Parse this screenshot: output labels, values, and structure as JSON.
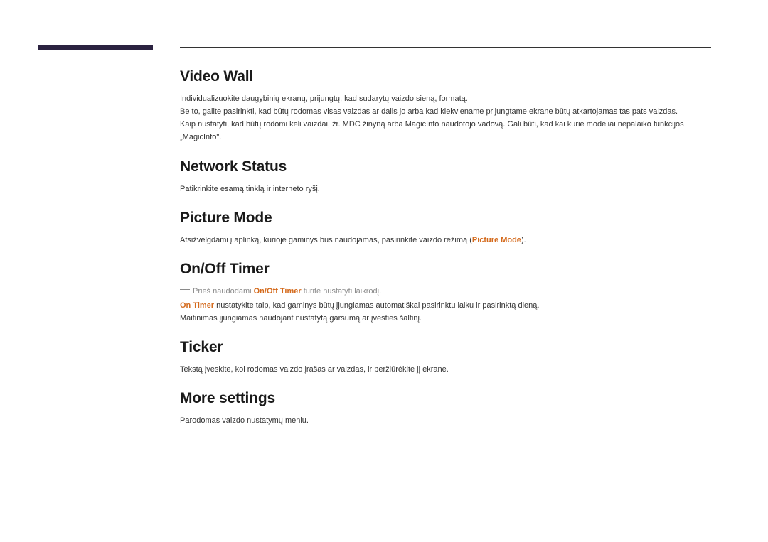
{
  "sections": {
    "videoWall": {
      "heading": "Video Wall",
      "p1": "Individualizuokite daugybinių ekranų, prijungtų, kad sudarytų vaizdo sieną, formatą.",
      "p2": "Be to, galite pasirinkti, kad būtų rodomas visas vaizdas ar dalis jo arba kad kiekviename prijungtame ekrane būtų atkartojamas tas pats vaizdas.",
      "p3": "Kaip nustatyti, kad būtų rodomi keli vaizdai, žr. MDC žinyną arba MagicInfo naudotojo vadovą. Gali būti, kad kai kurie modeliai nepalaiko funkcijos „MagicInfo\"."
    },
    "networkStatus": {
      "heading": "Network Status",
      "p1": "Patikrinkite esamą tinklą ir interneto ryšį."
    },
    "pictureMode": {
      "heading": "Picture Mode",
      "p1_before": "Atsižvelgdami į aplinką, kurioje gaminys bus naudojamas, pasirinkite vaizdo režimą (",
      "p1_emph": "Picture Mode",
      "p1_after": ")."
    },
    "onOffTimer": {
      "heading": "On/Off Timer",
      "note_before": "Prieš naudodami ",
      "note_emph": "On/Off Timer",
      "note_after": " turite nustatyti laikrodį.",
      "p1_emph": "On Timer",
      "p1_after": " nustatykite taip, kad gaminys būtų įjungiamas automatiškai pasirinktu laiku ir pasirinktą dieną.",
      "p2": "Maitinimas įjungiamas naudojant nustatytą garsumą ar įvesties šaltinį."
    },
    "ticker": {
      "heading": "Ticker",
      "p1": "Tekstą įveskite, kol rodomas vaizdo įrašas ar vaizdas, ir peržiūrėkite jį ekrane."
    },
    "moreSettings": {
      "heading": "More settings",
      "p1": "Parodomas vaizdo nustatymų meniu."
    }
  }
}
